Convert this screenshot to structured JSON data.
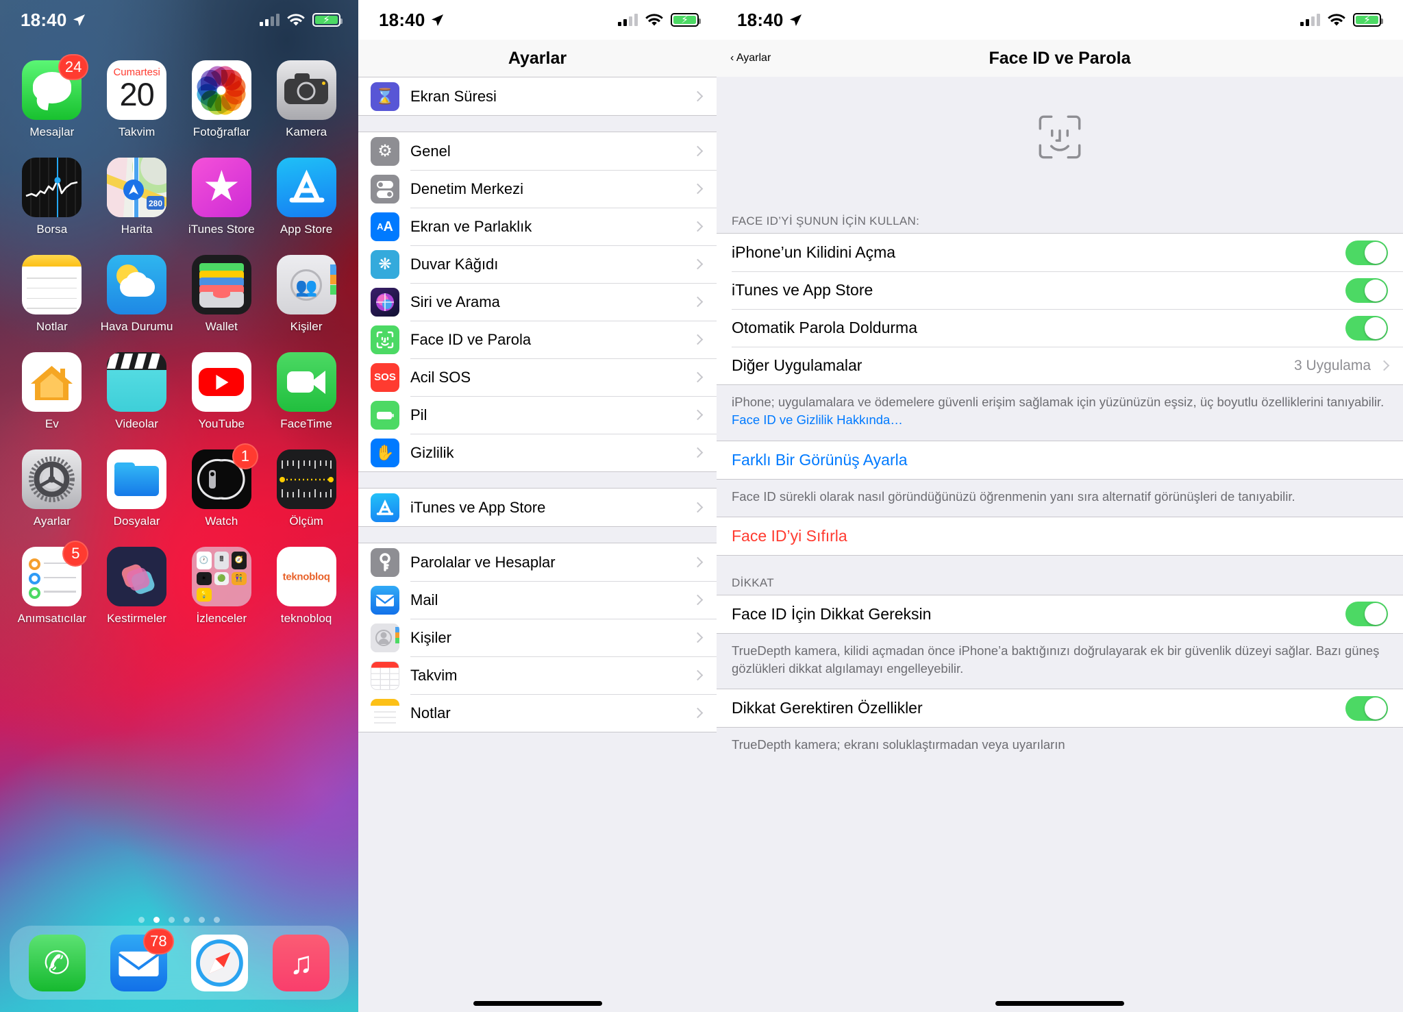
{
  "statusbar": {
    "time": "18:40",
    "location_icon": "location-arrow-icon",
    "signal_icon": "cellular-bars-icon",
    "wifi_icon": "wifi-icon",
    "battery_icon": "battery-charging-icon"
  },
  "home": {
    "apps": [
      {
        "label": "Mesajlar",
        "icon": "messages-icon",
        "badge": "24"
      },
      {
        "label": "Takvim",
        "icon": "calendar-icon",
        "cal_day": "Cumartesi",
        "cal_date": "20"
      },
      {
        "label": "Fotoğraflar",
        "icon": "photos-icon"
      },
      {
        "label": "Kamera",
        "icon": "camera-icon"
      },
      {
        "label": "Borsa",
        "icon": "stocks-icon"
      },
      {
        "label": "Harita",
        "icon": "maps-icon",
        "road_shield": "280"
      },
      {
        "label": "iTunes Store",
        "icon": "itunes-store-icon"
      },
      {
        "label": "App Store",
        "icon": "app-store-icon"
      },
      {
        "label": "Notlar",
        "icon": "notes-icon"
      },
      {
        "label": "Hava Durumu",
        "icon": "weather-icon"
      },
      {
        "label": "Wallet",
        "icon": "wallet-icon"
      },
      {
        "label": "Kişiler",
        "icon": "contacts-icon"
      },
      {
        "label": "Ev",
        "icon": "home-app-icon"
      },
      {
        "label": "Videolar",
        "icon": "videos-icon"
      },
      {
        "label": "YouTube",
        "icon": "youtube-icon"
      },
      {
        "label": "FaceTime",
        "icon": "facetime-icon"
      },
      {
        "label": "Ayarlar",
        "icon": "settings-gear-icon"
      },
      {
        "label": "Dosyalar",
        "icon": "files-icon"
      },
      {
        "label": "Watch",
        "icon": "watch-icon",
        "badge": "1"
      },
      {
        "label": "Ölçüm",
        "icon": "measure-icon"
      },
      {
        "label": "Anımsatıcılar",
        "icon": "reminders-icon",
        "badge": "5"
      },
      {
        "label": "Kestirmeler",
        "icon": "shortcuts-icon"
      },
      {
        "label": "İzlenceler",
        "icon": "utilities-folder-icon"
      },
      {
        "label": "teknobloq",
        "icon": "teknobloq-icon",
        "wordmark": "teknobloq"
      }
    ],
    "page_dots": {
      "count": 6,
      "active_index": 1
    },
    "dock": [
      {
        "label": "Telefon",
        "icon": "phone-icon"
      },
      {
        "label": "Mail",
        "icon": "mail-icon",
        "badge": "78"
      },
      {
        "label": "Safari",
        "icon": "safari-icon"
      },
      {
        "label": "Müzik",
        "icon": "music-icon"
      }
    ]
  },
  "settings": {
    "title": "Ayarlar",
    "groups": [
      {
        "rows": [
          {
            "label": "Ekran Süresi",
            "icon": "hourglass-icon",
            "glyph": "⌛"
          }
        ]
      },
      {
        "rows": [
          {
            "label": "Genel",
            "icon": "gear-icon",
            "glyph": "⚙"
          },
          {
            "label": "Denetim Merkezi",
            "icon": "control-center-icon",
            "glyph": "◉"
          },
          {
            "label": "Ekran ve Parlaklık",
            "icon": "display-brightness-icon",
            "glyph": "AA"
          },
          {
            "label": "Duvar Kâğıdı",
            "icon": "wallpaper-icon",
            "glyph": "❀"
          },
          {
            "label": "Siri ve Arama",
            "icon": "siri-icon",
            "glyph": "✦"
          },
          {
            "label": "Face ID ve Parola",
            "icon": "face-id-icon",
            "glyph": "☺"
          },
          {
            "label": "Acil SOS",
            "icon": "sos-icon",
            "glyph": "SOS"
          },
          {
            "label": "Pil",
            "icon": "battery-icon",
            "glyph": "▭"
          },
          {
            "label": "Gizlilik",
            "icon": "privacy-hand-icon",
            "glyph": "✋"
          }
        ]
      },
      {
        "rows": [
          {
            "label": "iTunes ve App Store",
            "icon": "app-store-icon",
            "glyph": "A"
          }
        ]
      },
      {
        "rows": [
          {
            "label": "Parolalar ve Hesaplar",
            "icon": "key-icon",
            "glyph": "⚿"
          },
          {
            "label": "Mail",
            "icon": "mail-icon",
            "glyph": "✉"
          },
          {
            "label": "Kişiler",
            "icon": "contacts-icon",
            "glyph": "👥"
          },
          {
            "label": "Takvim",
            "icon": "calendar-icon",
            "glyph": "📅"
          },
          {
            "label": "Notlar",
            "icon": "notes-icon",
            "glyph": "📝"
          }
        ]
      }
    ]
  },
  "faceid": {
    "back_label": "Ayarlar",
    "title": "Face ID ve Parola",
    "hero_icon": "face-id-large-icon",
    "section_use_header": "FACE ID’Yİ ŞUNUN İÇİN KULLAN:",
    "use_rows": [
      {
        "label": "iPhone’un Kilidini Açma",
        "toggle": "on"
      },
      {
        "label": "iTunes ve App Store",
        "toggle": "on"
      },
      {
        "label": "Otomatik Parola Doldurma",
        "toggle": "on"
      }
    ],
    "other_apps": {
      "label": "Diğer Uygulamalar",
      "value": "3 Uygulama"
    },
    "note_1": "iPhone; uygulamalara ve ödemelere güvenli erişim sağlamak için yüzünüzün eşsiz, üç boyutlu özelliklerini tanıyabilir.",
    "note_1_link": "Face ID ve Gizlilik Hakkında…",
    "alt_appearance_link": "Farklı Bir Görünüş Ayarla",
    "note_2": "Face ID sürekli olarak nasıl göründüğünüzü öğrenmenin yanı sıra alternatif görünüşleri de tanıyabilir.",
    "reset_link": "Face ID’yi Sıfırla",
    "section_attention_header": "DİKKAT",
    "attention_rows": [
      {
        "label": "Face ID İçin Dikkat Gereksin",
        "toggle": "on"
      }
    ],
    "note_3": "TrueDepth kamera, kilidi açmadan önce iPhone’a baktığınızı doğrulayarak ek bir güvenlik düzeyi sağlar. Bazı güneş gözlükleri dikkat algılamayı engelleyebilir.",
    "attention_rows_2": [
      {
        "label": "Dikkat Gerektiren Özellikler",
        "toggle": "on"
      }
    ],
    "note_4": "TrueDepth kamera; ekranı soluklaştırmadan veya uyarıların"
  },
  "colors": {
    "ios_blue": "#007aff",
    "ios_red": "#ff3b30",
    "ios_green": "#4cd964",
    "group_bg": "#efeff4",
    "separator": "#c8c7cc",
    "secondary_text": "#6d6d72"
  }
}
